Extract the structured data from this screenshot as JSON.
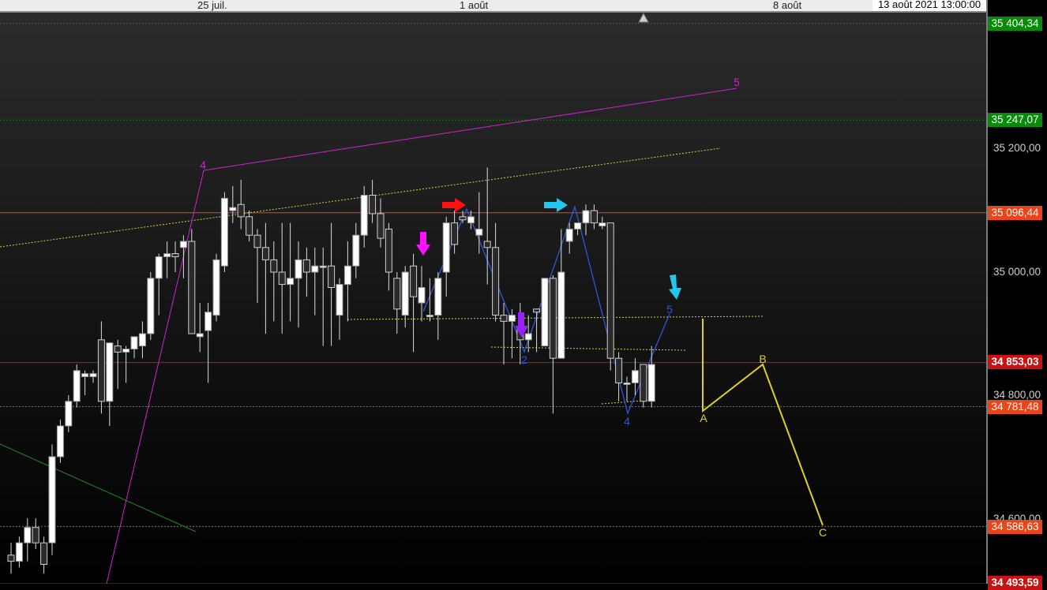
{
  "dates": {
    "labels": [
      "25 juil.",
      "1 août",
      "8 août"
    ],
    "cursor": "13 août 2021 13:00:00"
  },
  "chart_data": {
    "type": "candlestick",
    "y_axis": {
      "min": 34490,
      "max": 35415,
      "ticks": [
        "35 200,00",
        "35 000,00",
        "34 800,00",
        "34 600,00"
      ]
    },
    "levels": [
      {
        "value": 35404.34,
        "label": "35 404,34",
        "color": "#0a8a0a",
        "style": "dotted"
      },
      {
        "value": 35247.07,
        "label": "35 247,07",
        "color": "#0a8a0a",
        "style": "dotted"
      },
      {
        "value": 35096.44,
        "label": "35 096,44",
        "color": "#e8451a",
        "style": "solid"
      },
      {
        "value": 34853.03,
        "label": "34 853,03",
        "color": "#cc1111",
        "style": "solid"
      },
      {
        "value": 34781.48,
        "label": "34 781,48",
        "color": "#e8451a",
        "style": "dotted"
      },
      {
        "value": 34586.63,
        "label": "34 586,63",
        "color": "#e8451a",
        "style": "dotted"
      },
      {
        "value": 34493.59,
        "label": "34 493,59",
        "color": "#cc1111",
        "style": "solid"
      }
    ],
    "candles": [
      [
        34540,
        34560,
        34510,
        34530
      ],
      [
        34530,
        34570,
        34520,
        34560
      ],
      [
        34560,
        34600,
        34530,
        34585
      ],
      [
        34585,
        34600,
        34550,
        34560
      ],
      [
        34560,
        34570,
        34510,
        34525
      ],
      [
        34560,
        34720,
        34540,
        34700
      ],
      [
        34700,
        34760,
        34690,
        34750
      ],
      [
        34750,
        34800,
        34740,
        34790
      ],
      [
        34790,
        34850,
        34780,
        34840
      ],
      [
        34830,
        34840,
        34800,
        34835
      ],
      [
        34830,
        34840,
        34820,
        34835
      ],
      [
        34890,
        34920,
        34770,
        34790
      ],
      [
        34790,
        34885,
        34750,
        34885
      ],
      [
        34880,
        34890,
        34810,
        34870
      ],
      [
        34870,
        34880,
        34820,
        34875
      ],
      [
        34875,
        34890,
        34860,
        34895
      ],
      [
        34880,
        34920,
        34860,
        34900
      ],
      [
        34900,
        35000,
        34890,
        34990
      ],
      [
        34990,
        35030,
        34930,
        35025
      ],
      [
        35025,
        35050,
        34990,
        35030
      ],
      [
        35030,
        35050,
        35000,
        35025
      ],
      [
        35040,
        35060,
        34990,
        35050
      ],
      [
        35050,
        35070,
        34900,
        34900
      ],
      [
        34895,
        34950,
        34870,
        34900
      ],
      [
        34905,
        34950,
        34820,
        34935
      ],
      [
        34930,
        35030,
        34920,
        35020
      ],
      [
        35010,
        35130,
        35000,
        35120
      ],
      [
        35100,
        35140,
        35080,
        35105
      ],
      [
        35110,
        35150,
        35070,
        35090
      ],
      [
        35090,
        35100,
        35050,
        35060
      ],
      [
        35060,
        35070,
        34950,
        35040
      ],
      [
        35040,
        35080,
        34900,
        35020
      ],
      [
        35020,
        35050,
        34920,
        35000
      ],
      [
        35000,
        35080,
        34900,
        34980
      ],
      [
        34980,
        35080,
        34920,
        34990
      ],
      [
        34990,
        35050,
        34910,
        35020
      ],
      [
        35020,
        35040,
        34960,
        35000
      ],
      [
        35000,
        35040,
        34930,
        35010
      ],
      [
        35010,
        35040,
        34880,
        35010
      ],
      [
        35010,
        35080,
        34880,
        34975
      ],
      [
        34930,
        34990,
        34890,
        34980
      ],
      [
        34980,
        35050,
        34920,
        35010
      ],
      [
        35010,
        35080,
        34990,
        35060
      ],
      [
        35060,
        35140,
        35040,
        35125
      ],
      [
        35125,
        35150,
        35080,
        35095
      ],
      [
        35095,
        35120,
        35040,
        35055
      ],
      [
        35070,
        35080,
        34970,
        35000
      ],
      [
        34990,
        35000,
        34900,
        34940
      ],
      [
        34930,
        35010,
        34910,
        35000
      ],
      [
        35010,
        35030,
        34870,
        34960
      ],
      [
        34950,
        35010,
        34920,
        34975
      ],
      [
        34930,
        34990,
        34920,
        34930
      ],
      [
        34930,
        35000,
        34890,
        34990
      ],
      [
        35000,
        35090,
        34960,
        35080
      ],
      [
        35080,
        35100,
        35030,
        35045
      ],
      [
        35090,
        35100,
        35080,
        35085
      ],
      [
        35080,
        35100,
        35070,
        35090
      ],
      [
        35060,
        35130,
        35030,
        35070
      ],
      [
        35050,
        35170,
        34980,
        35040
      ],
      [
        35040,
        35080,
        34920,
        34930
      ],
      [
        34930,
        34950,
        34850,
        34920
      ],
      [
        34920,
        34940,
        34860,
        34930
      ],
      [
        34910,
        34950,
        34850,
        34890
      ],
      [
        34890,
        34930,
        34870,
        34900
      ],
      [
        34940,
        34940,
        34870,
        34935
      ],
      [
        34880,
        34990,
        34880,
        34990
      ],
      [
        34990,
        34995,
        34770,
        34860
      ],
      [
        34860,
        35070,
        34860,
        35000
      ],
      [
        35050,
        35080,
        35030,
        35070
      ],
      [
        35070,
        35080,
        35060,
        35080
      ],
      [
        35080,
        35110,
        35060,
        35100
      ],
      [
        35100,
        35110,
        35070,
        35080
      ],
      [
        35075,
        35090,
        35070,
        35080
      ],
      [
        35080,
        35080,
        34840,
        34860
      ],
      [
        34860,
        34870,
        34790,
        34820
      ],
      [
        34820,
        34830,
        34790,
        34820
      ],
      [
        34820,
        34860,
        34800,
        34840
      ],
      [
        34850,
        34850,
        34780,
        34790
      ],
      [
        34790,
        34880,
        34780,
        34850
      ]
    ],
    "wave_labels": {
      "magenta": [
        "4",
        "5"
      ],
      "blue": [
        "2",
        "4",
        "5"
      ],
      "yellow": [
        "A",
        "B",
        "C"
      ]
    }
  }
}
